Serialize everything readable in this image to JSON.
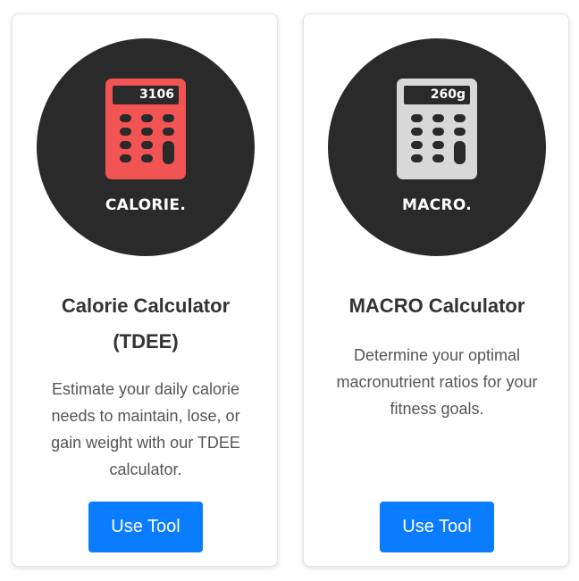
{
  "cards": [
    {
      "thumbnail": {
        "screen_value": "3106",
        "label": "CALORIE.",
        "calculator_color": "#f25353",
        "background_color": "#2a2a2a",
        "icon": "calculator-icon"
      },
      "title": "Calorie Calculator (TDEE)",
      "description": "Estimate your daily calorie needs to maintain, lose, or gain weight with our TDEE calculator.",
      "button_label": "Use Tool"
    },
    {
      "thumbnail": {
        "screen_value": "260g",
        "label": "MACRO.",
        "calculator_color": "#d8d8d8",
        "background_color": "#2a2a2a",
        "icon": "calculator-icon"
      },
      "title": "MACRO Calculator",
      "description": "Determine your optimal macronutrient ratios for your fitness goals.",
      "button_label": "Use Tool"
    }
  ],
  "colors": {
    "button_bg": "#0a7cff",
    "title_text": "#333333",
    "description_text": "#555555"
  }
}
